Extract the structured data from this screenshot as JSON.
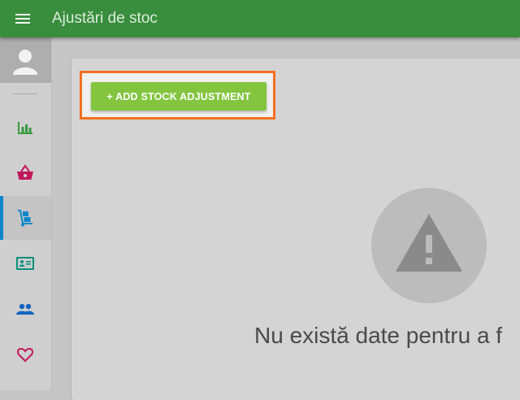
{
  "header": {
    "title": "Ajustări de stoc",
    "menu_icon": "hamburger-menu-icon",
    "background": "#398e3d"
  },
  "sidebar": {
    "avatar_icon": "user-avatar-icon",
    "items": [
      {
        "icon": "bar-chart-icon",
        "color": "#3a9a3e",
        "active": false
      },
      {
        "icon": "shopping-basket-icon",
        "color": "#c2185b",
        "active": false
      },
      {
        "icon": "hand-truck-icon",
        "color": "#0d87c9",
        "active": true
      },
      {
        "icon": "id-card-icon",
        "color": "#0b8f7a",
        "active": false
      },
      {
        "icon": "people-icon",
        "color": "#1565c0",
        "active": false
      },
      {
        "icon": "heart-outline-icon",
        "color": "#c2185b",
        "active": false
      }
    ],
    "active_indicator_color": "#0d87c9"
  },
  "main": {
    "add_button_label": "+ ADD STOCK ADJUSTMENT",
    "add_button_color": "#83c53f",
    "highlight_color": "#f37021",
    "empty_icon": "warning-triangle-icon",
    "empty_message": "Nu există date pentru a f"
  }
}
